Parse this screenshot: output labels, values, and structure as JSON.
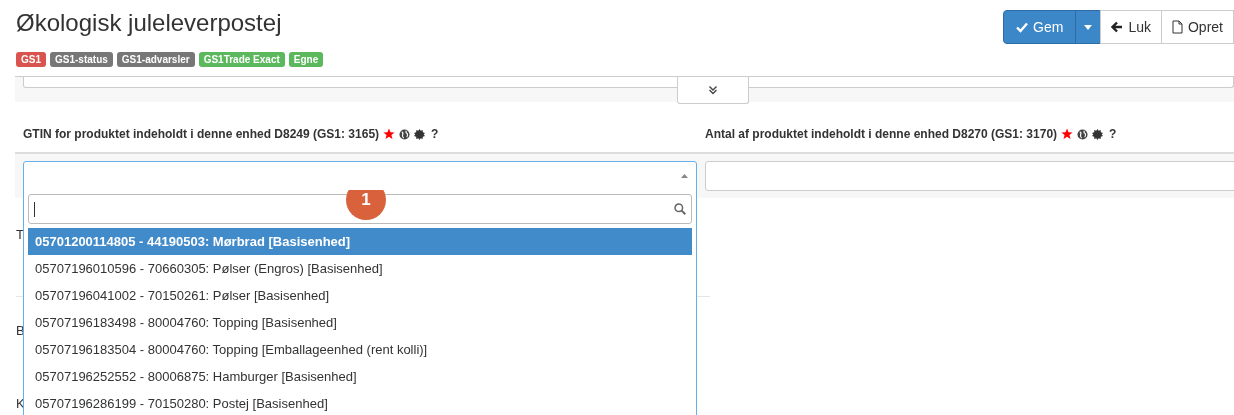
{
  "title": "Økologisk juleleverpostej",
  "toolbar": {
    "save": "Gem",
    "close": "Luk",
    "create": "Opret"
  },
  "badges": [
    {
      "label": "GS1",
      "color": "#d9534f"
    },
    {
      "label": "GS1-status",
      "color": "#777777"
    },
    {
      "label": "GS1-advarsler",
      "color": "#777777"
    },
    {
      "label": "GS1Trade Exact",
      "color": "#5cb85c"
    },
    {
      "label": "Egne",
      "color": "#5cb85c"
    }
  ],
  "fields": [
    {
      "label": "GTIN for produktet indeholdt i denne enhed D8249 (GS1: 3165)",
      "help": "?",
      "kind": "select"
    },
    {
      "label": "Antal af produktet indeholdt i denne enhed D8270 (GS1: 3170)",
      "help": "?",
      "kind": "text"
    }
  ],
  "background_texts": [
    {
      "text": "T",
      "kind": "small"
    },
    {
      "text": "B",
      "kind": "small"
    },
    {
      "text": "K",
      "kind": "small"
    }
  ],
  "dropdown": {
    "step_marker": "1",
    "options": [
      {
        "text": "05701200114805 - 44190503: Mørbrad [Basisenhed]",
        "selected": true
      },
      {
        "text": "05707196010596 - 70660305: Pølser (Engros)  [Basisenhed]",
        "selected": false
      },
      {
        "text": "05707196041002 - 70150261: Pølser  [Basisenhed]",
        "selected": false
      },
      {
        "text": "05707196183498 - 80004760: Topping [Basisenhed]",
        "selected": false
      },
      {
        "text": "05707196183504 - 80004760: Topping [Emballageenhed (rent kolli)]",
        "selected": false
      },
      {
        "text": "05707196252552 - 80006875: Hamburger [Basisenhed]",
        "selected": false
      },
      {
        "text": "05707196286199 - 70150280: Postej [Basisenhed]",
        "selected": false
      }
    ]
  }
}
